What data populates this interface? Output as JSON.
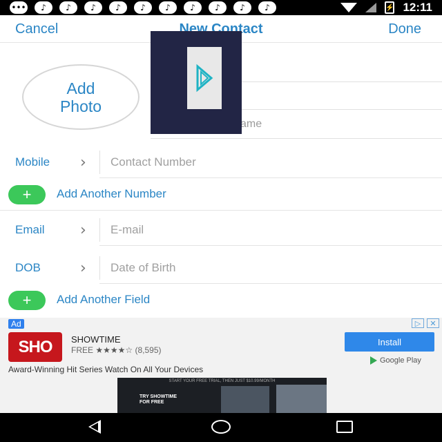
{
  "status_bar": {
    "time": "12:11",
    "icon_count": 11
  },
  "nav": {
    "cancel": "Cancel",
    "title": "New Contact",
    "done": "Done"
  },
  "header": {
    "add_photo_line1": "Add",
    "add_photo_line2": "Photo",
    "last_name_placeholder": "ame"
  },
  "rows": {
    "mobile": {
      "label": "Mobile",
      "placeholder": "Contact Number"
    },
    "add_number": "Add Another Number",
    "email": {
      "label": "Email",
      "placeholder": "E-mail"
    },
    "dob": {
      "label": "DOB",
      "placeholder": "Date of Birth"
    },
    "add_field": "Add Another Field"
  },
  "ad": {
    "badge": "Ad",
    "logo": "SHO",
    "title": "SHOWTIME",
    "price": "FREE",
    "stars": "★★★★☆",
    "rating_count": "(8,595)",
    "install": "Install",
    "store": "Google Play",
    "description": "Award-Winning Hit Series Watch On All Your Devices",
    "banner_top": "START YOUR FREE TRIAL, THEN JUST $10.99/MONTH",
    "banner_line1": "TRY SHOWTIME",
    "banner_line2": "FOR FREE"
  },
  "colors": {
    "accent": "#2b86c5",
    "add_button": "#3cc85a",
    "install": "#2f88e9",
    "overlay": "#222545"
  }
}
